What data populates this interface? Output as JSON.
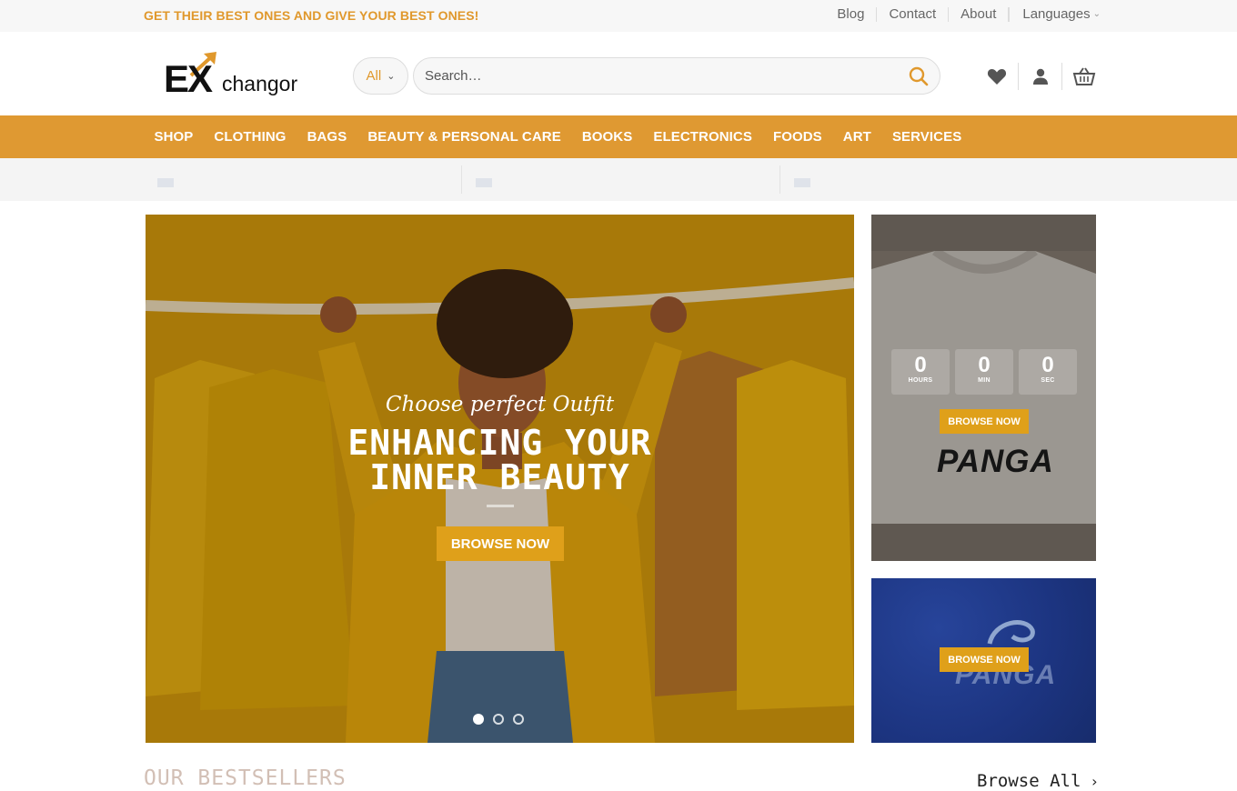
{
  "topbar": {
    "promo": "GET THEIR BEST ONES AND GIVE YOUR BEST ONES!",
    "links": [
      "Blog",
      "Contact",
      "About"
    ],
    "languages": "Languages"
  },
  "header": {
    "logo_ex": "EX",
    "logo_changor": "changor",
    "category": "All",
    "search_placeholder": "Search…"
  },
  "nav": [
    "SHOP",
    "CLOTHING",
    "BAGS",
    "BEAUTY & PERSONAL CARE",
    "BOOKS",
    "ELECTRONICS",
    "FOODS",
    "ART",
    "SERVICES"
  ],
  "hero": {
    "tagline": "Choose perfect Outfit",
    "headline_line1": "ENHANCING YOUR",
    "headline_line2": "INNER BEAUTY",
    "button": "BROWSE NOW",
    "slides": 3,
    "active_slide": 1
  },
  "side_banner_1": {
    "countdown": [
      {
        "num": "0",
        "unit": "HOURS"
      },
      {
        "num": "0",
        "unit": "MIN"
      },
      {
        "num": "0",
        "unit": "SEC"
      }
    ],
    "button": "BROWSE NOW",
    "brand": "PANGA"
  },
  "side_banner_2": {
    "button": "BROWSE NOW",
    "brand": "PANGA"
  },
  "bestsellers": {
    "title": "OUR BESTSELLERS",
    "browse_all": "Browse All"
  },
  "colors": {
    "accent": "#df9932",
    "button": "#dfa01a",
    "promo_text": "#e0982c"
  }
}
